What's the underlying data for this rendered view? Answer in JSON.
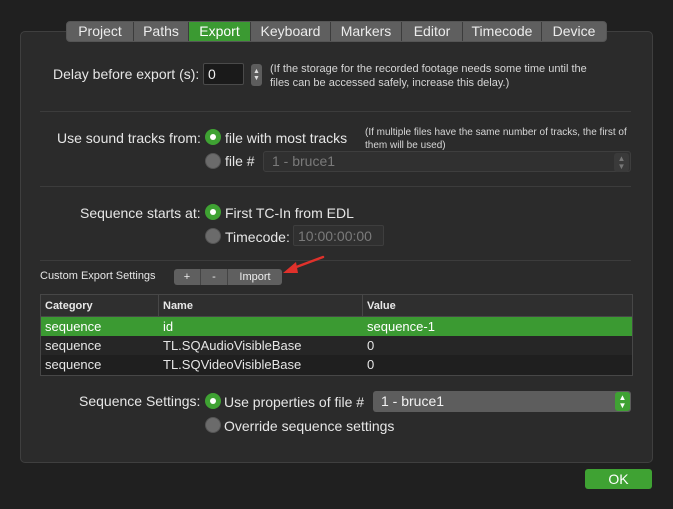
{
  "tabs": [
    "Project",
    "Paths",
    "Export",
    "Keyboard",
    "Markers",
    "Editor",
    "Timecode",
    "Device"
  ],
  "active_tab": "Export",
  "delay": {
    "label": "Delay before export (s):",
    "value": "0",
    "note": "(If the storage for the recorded footage needs some time until the files can be accessed safely, increase this delay.)"
  },
  "sound": {
    "label": "Use sound tracks from:",
    "opt1": "file with most tracks",
    "note": "(If multiple files have the same number of tracks, the first of them will be used)",
    "opt2": "file #",
    "file_select": "1 - bruce1"
  },
  "sequence_start": {
    "label": "Sequence starts at:",
    "opt1": "First TC-In from EDL",
    "opt2": "Timecode:",
    "timecode": "10:00:00:00"
  },
  "custom": {
    "label": "Custom Export Settings",
    "add": "+",
    "remove": "-",
    "import": "Import"
  },
  "table": {
    "headers": [
      "Category",
      "Name",
      "Value"
    ],
    "rows": [
      [
        "sequence",
        "id",
        "sequence-1"
      ],
      [
        "sequence",
        "TL.SQAudioVisibleBase",
        "0"
      ],
      [
        "sequence",
        "TL.SQVideoVisibleBase",
        "0"
      ]
    ]
  },
  "seq_settings": {
    "label": "Sequence Settings:",
    "opt1": "Use properties of file #",
    "file_select": "1 - bruce1",
    "opt2": "Override sequence settings"
  },
  "ok": "OK",
  "colors": {
    "accent": "#3fa233",
    "arrow": "#e0312b"
  }
}
